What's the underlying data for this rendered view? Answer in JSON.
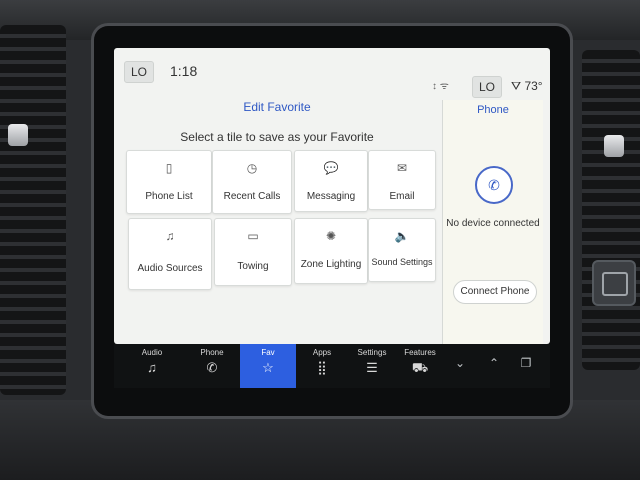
{
  "status_bar": {
    "left_badge": "LO",
    "time": "1:18",
    "status_icons": "↕ ᯤ",
    "right_badge": "LO",
    "temp_icon": "car-fan-icon",
    "temperature": "73°"
  },
  "favorites": {
    "title": "Edit Favorite",
    "subtitle": "Select a tile to save as your Favorite",
    "tiles": [
      {
        "label": "Phone List",
        "icon": "phone-list-icon",
        "glyph": "▯"
      },
      {
        "label": "Recent Calls",
        "icon": "recent-calls-icon",
        "glyph": "◷"
      },
      {
        "label": "Messaging",
        "icon": "messaging-icon",
        "glyph": "💬"
      },
      {
        "label": "Email",
        "icon": "email-icon",
        "glyph": "✉"
      },
      {
        "label": "Audio Sources",
        "icon": "audio-sources-icon",
        "glyph": "♫"
      },
      {
        "label": "Towing",
        "icon": "towing-icon",
        "glyph": "▭"
      },
      {
        "label": "Zone Lighting",
        "icon": "zone-lighting-icon",
        "glyph": "✺"
      },
      {
        "label": "Sound Settings",
        "icon": "sound-settings-icon",
        "glyph": "🔈"
      }
    ]
  },
  "phone_panel": {
    "title": "Phone",
    "status": "No device connected",
    "connect_label": "Connect Phone"
  },
  "nav": {
    "items": [
      {
        "label": "Audio",
        "glyph": "♫"
      },
      {
        "label": "Phone",
        "glyph": "✆"
      },
      {
        "label": "Fav",
        "glyph": "☆"
      },
      {
        "label": "Apps",
        "glyph": "⣿"
      },
      {
        "label": "Settings",
        "glyph": "☰"
      },
      {
        "label": "Features",
        "glyph": "⛟"
      }
    ],
    "extra_glyphs": [
      "⌄",
      "⌃",
      "❐"
    ]
  },
  "colors": {
    "accent": "#2f58c4",
    "nav_active": "#2d5fe0",
    "screen_bg": "#f2f3f1"
  }
}
